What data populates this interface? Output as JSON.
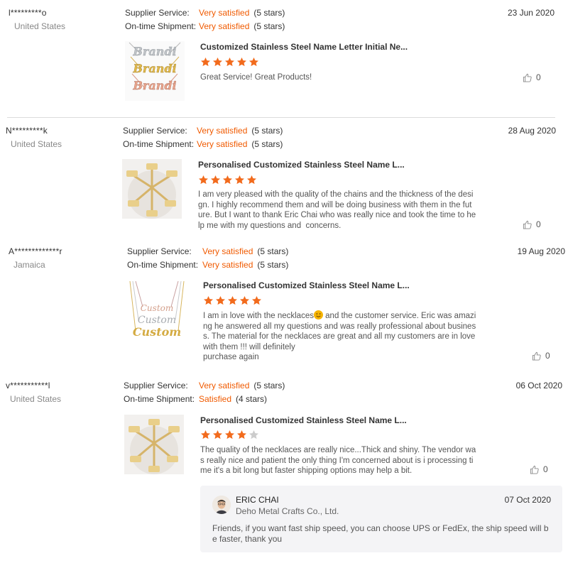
{
  "reviews": [
    {
      "buyer": "l*********o",
      "country": "United States",
      "supplier_label": "Supplier Service:",
      "supplier_value": "Very satisfied",
      "supplier_stars": "(5 stars)",
      "shipment_label": "On-time Shipment:",
      "shipment_value": "Very satisfied",
      "shipment_stars": "(5 stars)",
      "date": "23 Jun 2020",
      "product_title": "Customized Stainless Steel Name Letter Initial Ne...",
      "rating": 5,
      "comment": "Great Service! Great Products!",
      "likes": "0"
    },
    {
      "buyer": "N*********k",
      "country": "United States",
      "supplier_label": "Supplier Service:",
      "supplier_value": "Very satisfied",
      "supplier_stars": "(5 stars)",
      "shipment_label": "On-time Shipment:",
      "shipment_value": "Very satisfied",
      "shipment_stars": "(5 stars)",
      "date": "28 Aug 2020",
      "product_title": "Personalised Customized Stainless Steel Name L...",
      "rating": 5,
      "comment": "I am very pleased with the quality of the chains and the thickness of the desi\ngn. I highly recommend them and will be doing business with them in the fut\nure. But I want to thank Eric Chai who was really nice and took the time to he\nlp me with my questions and  concerns.",
      "likes": "0"
    },
    {
      "buyer": "A*************r",
      "country": "Jamaica",
      "supplier_label": "Supplier Service:",
      "supplier_value": "Very satisfied",
      "supplier_stars": "(5 stars)",
      "shipment_label": "On-time Shipment:",
      "shipment_value": "Very satisfied",
      "shipment_stars": "(5 stars)",
      "date": "19 Aug 2020",
      "product_title": "Personalised Customized Stainless Steel Name L...",
      "rating": 5,
      "comment_before_emoji": "I am in love with the necklaces",
      "comment": " and the customer service. Eric was amazi\nng he answered all my questions and was really professional about busines\ns. The material for the necklaces are great and all my customers are in love\nwith them !!! will definitely\npurchase again",
      "likes": "0"
    },
    {
      "buyer": "v***********l",
      "country": "United States",
      "supplier_label": "Supplier Service:",
      "supplier_value": "Very satisfied",
      "supplier_stars": "(5 stars)",
      "shipment_label": "On-time Shipment:",
      "shipment_value": "Satisfied",
      "shipment_stars": "(4 stars)",
      "date": "06 Oct 2020",
      "product_title": "Personalised Customized Stainless Steel Name L...",
      "rating": 4,
      "comment": "The quality of the necklaces are really nice...Thick and shiny. The vendor wa\ns really nice and patient the only thing I'm concerned about is i processing ti\nme it's a bit long but faster shipping options may help a bit.",
      "likes": "0"
    }
  ],
  "reply": {
    "name": "ERIC CHAI",
    "company": "Deho Metal Crafts Co., Ltd.",
    "date": "07 Oct 2020",
    "text": "Friends, if you want fast ship speed, you can choose UPS or FedEx, the ship speed will b\ne faster, thank you"
  },
  "colors": {
    "accent": "#f05a00",
    "star_filled": "#f26b1d",
    "star_empty": "#cccccc"
  },
  "thumbnail_texts": {
    "name1": "Brandi",
    "custom": "Custom"
  }
}
